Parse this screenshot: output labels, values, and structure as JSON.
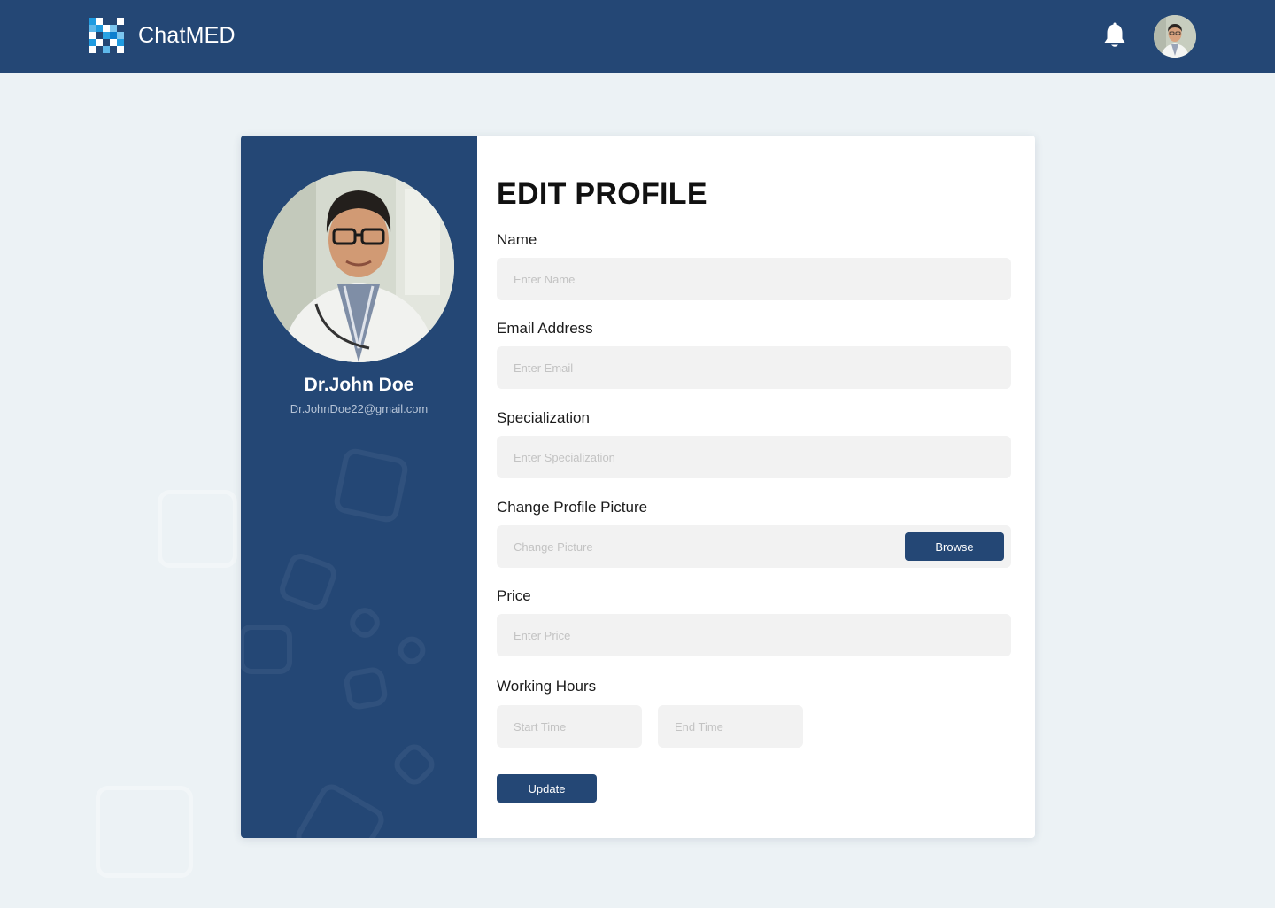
{
  "header": {
    "brand_name": "ChatMED",
    "notification_icon": "bell-icon",
    "avatar_icon": "user-avatar"
  },
  "profile": {
    "name": "Dr.John Doe",
    "email": "Dr.JohnDoe22@gmail.com"
  },
  "form": {
    "title": "EDIT PROFILE",
    "name_label": "Name",
    "name_placeholder": "Enter Name",
    "email_label": "Email Address",
    "email_placeholder": "Enter Email",
    "specialization_label": "Specialization",
    "specialization_placeholder": "Enter Specialization",
    "picture_label": "Change Profile Picture",
    "picture_placeholder": "Change Picture",
    "browse_label": "Browse",
    "price_label": "Price",
    "price_placeholder": "Enter Price",
    "hours_label": "Working Hours",
    "start_placeholder": "Start Time",
    "end_placeholder": "End Time",
    "update_label": "Update"
  },
  "colors": {
    "primary": "#244775",
    "background": "#ecf2f5",
    "input_bg": "#f2f2f2"
  }
}
